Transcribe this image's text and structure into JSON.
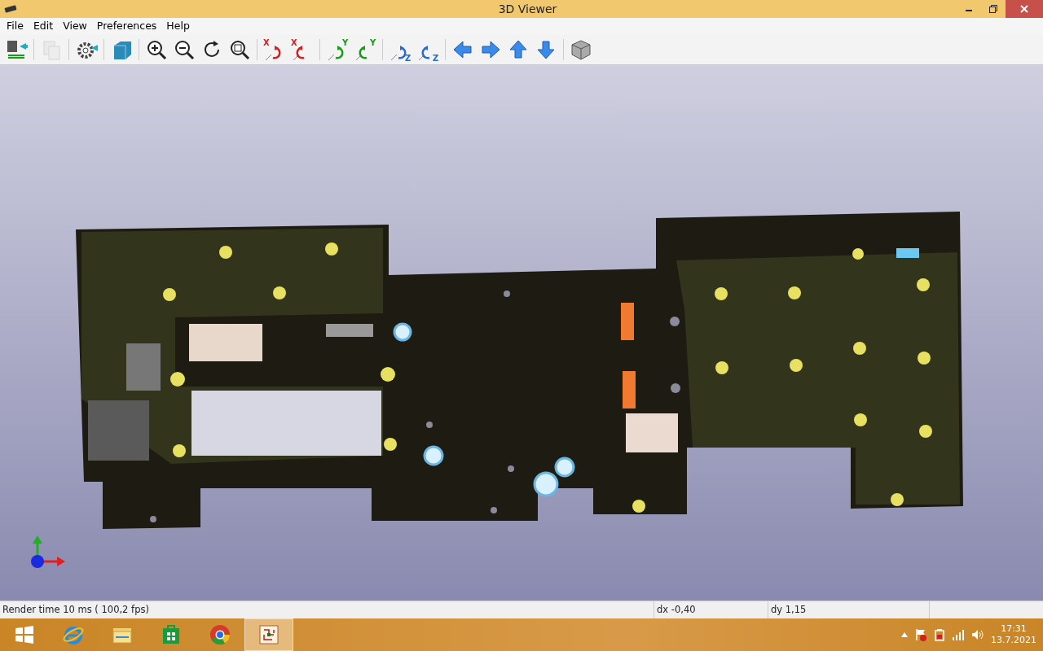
{
  "window": {
    "title": "3D Viewer"
  },
  "menu": [
    {
      "label": "File"
    },
    {
      "label": "Edit"
    },
    {
      "label": "View"
    },
    {
      "label": "Preferences"
    },
    {
      "label": "Help"
    }
  ],
  "toolbar": [
    {
      "kind": "reload",
      "disabled": false
    },
    {
      "kind": "separator"
    },
    {
      "kind": "copy",
      "disabled": true
    },
    {
      "kind": "separator"
    },
    {
      "kind": "settings",
      "disabled": false
    },
    {
      "kind": "separator"
    },
    {
      "kind": "cube",
      "disabled": false
    },
    {
      "kind": "separator"
    },
    {
      "kind": "zoom-in",
      "disabled": false
    },
    {
      "kind": "zoom-out",
      "disabled": false
    },
    {
      "kind": "redraw",
      "disabled": false
    },
    {
      "kind": "zoom-fit",
      "disabled": false
    },
    {
      "kind": "separator"
    },
    {
      "kind": "rotate-cw",
      "axis": "X",
      "disabled": false
    },
    {
      "kind": "rotate-ccw",
      "axis": "X",
      "disabled": false
    },
    {
      "kind": "separator"
    },
    {
      "kind": "rotate-cw",
      "axis": "Y",
      "disabled": false
    },
    {
      "kind": "rotate-ccw",
      "axis": "Y",
      "disabled": false
    },
    {
      "kind": "separator"
    },
    {
      "kind": "rotate-cw",
      "axis": "Z",
      "disabled": false
    },
    {
      "kind": "rotate-ccw",
      "axis": "Z",
      "disabled": false
    },
    {
      "kind": "separator"
    },
    {
      "kind": "arrow-left",
      "disabled": false
    },
    {
      "kind": "arrow-right",
      "disabled": false
    },
    {
      "kind": "arrow-up",
      "disabled": false
    },
    {
      "kind": "arrow-down",
      "disabled": false
    },
    {
      "kind": "separator"
    },
    {
      "kind": "box",
      "disabled": false
    }
  ],
  "status_bar": [
    {
      "text": "Render time 10 ms ( 100,2 fps)"
    },
    {
      "text": "dx -0,40"
    },
    {
      "text": "dy 1,15"
    }
  ],
  "taskbar": {
    "apps": [
      {
        "kind": "browser-e",
        "selected": false
      },
      {
        "kind": "folder",
        "selected": false
      },
      {
        "kind": "store",
        "selected": false
      },
      {
        "kind": "chrome",
        "selected": false
      },
      {
        "kind": "pcb",
        "selected": true
      }
    ],
    "clock": {
      "time": "17:31",
      "date": "13.7.2021"
    }
  }
}
